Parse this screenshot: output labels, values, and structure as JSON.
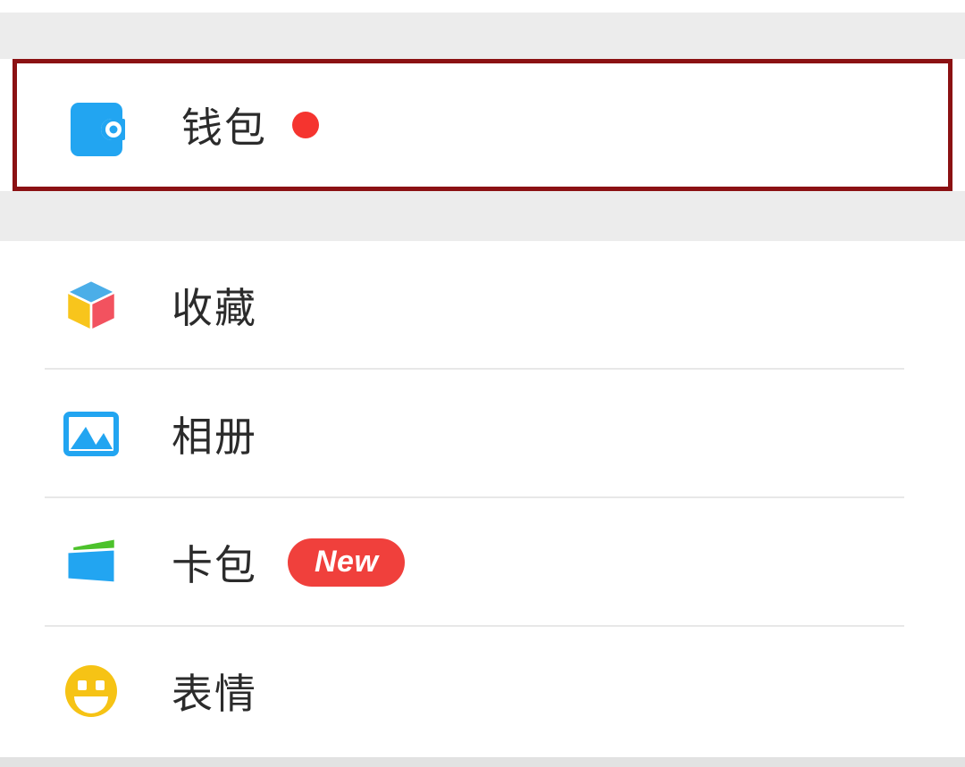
{
  "colors": {
    "highlight_border": "#8B1113",
    "page_background": "#ffffff",
    "strip_gray": "#ececec",
    "bottom_gray": "#e2e2e2",
    "divider": "#e8e8e8",
    "badge_red": "#F0403C",
    "dot_red": "#F5342F",
    "icon_blue": "#22A5F1",
    "icon_yellow": "#F8C51C",
    "icon_red": "#F2525F",
    "icon_green": "#4CC22B",
    "label_text": "#2b2b2b"
  },
  "highlighted_section": {
    "item": {
      "label": "钱包",
      "icon": "wallet-icon",
      "badge_type": "dot",
      "has_red_dot": true
    }
  },
  "list": {
    "items": [
      {
        "label": "收藏",
        "icon": "cube-icon",
        "badge": null,
        "has_divider": true
      },
      {
        "label": "相册",
        "icon": "photo-icon",
        "badge": null,
        "has_divider": true
      },
      {
        "label": "卡包",
        "icon": "cardholder-icon",
        "badge": "New",
        "has_divider": true
      },
      {
        "label": "表情",
        "icon": "smiley-icon",
        "badge": null,
        "has_divider": false
      }
    ]
  }
}
